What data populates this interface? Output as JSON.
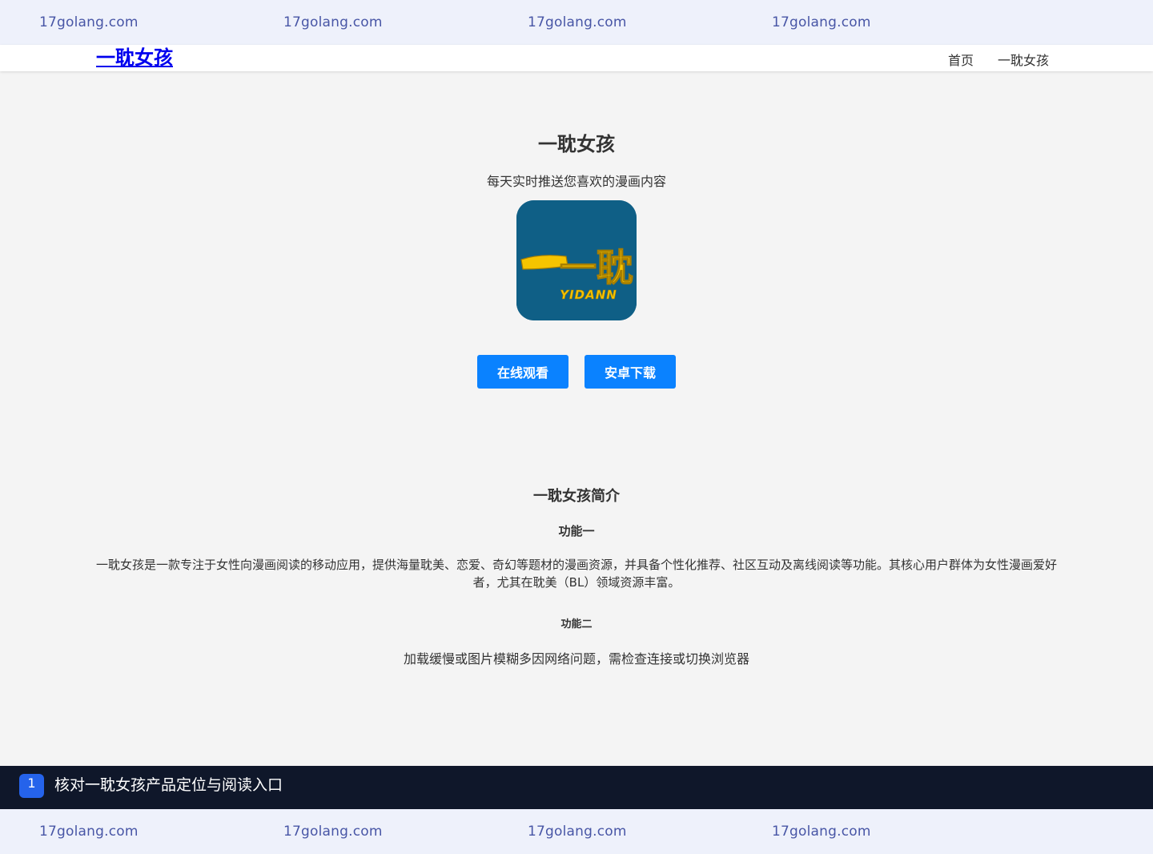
{
  "watermark": {
    "top": [
      "17golang.com",
      "17golang.com",
      "17golang.com",
      "17golang.com"
    ],
    "bottom": [
      "17golang.com",
      "17golang.com",
      "17golang.com",
      "17golang.com"
    ],
    "color": "#4856a6"
  },
  "navbar": {
    "brand": "一耽女孩",
    "links": [
      "首页",
      "一耽女孩"
    ]
  },
  "hero": {
    "title": "一耽女孩",
    "subtitle": "每天实时推送您喜欢的漫画内容",
    "logo_main": "一耽",
    "logo_sub": "YIDANN",
    "logo_colors": {
      "background": "#0f5f86",
      "text": "#f5c400"
    }
  },
  "buttons": {
    "watch": "在线观看",
    "download": "安卓下载",
    "color": "#0a82ff"
  },
  "intro": {
    "title": "一耽女孩简介",
    "feature1_title": "功能一",
    "feature1_text": "一耽女孩是一款专注于女性向漫画阅读的移动应用，提供海量耽美、恋爱、奇幻等题材的漫画资源，并具备个性化推荐、社区互动及离线阅读等功能。其核心用户群体为女性漫画爱好者，尤其在耽美（BL）领域资源丰富。",
    "feature2_title": "功能二",
    "feature2_text": "加载缓慢或图片模糊多因网络问题，需检查连接或切换浏览器"
  },
  "banner": {
    "badge": "1",
    "text": "核对一耽女孩产品定位与阅读入口",
    "background": "#0f172a"
  }
}
